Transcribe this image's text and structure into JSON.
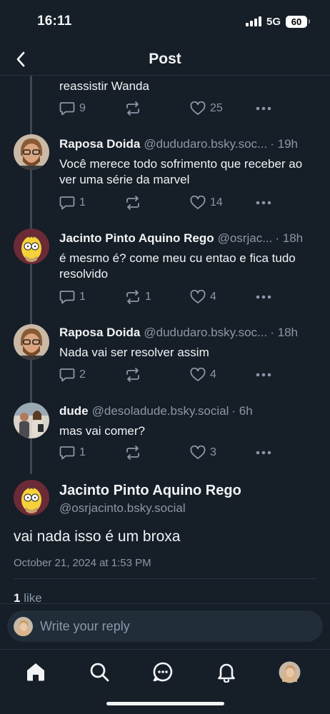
{
  "status_bar": {
    "time": "16:11",
    "network": "5G",
    "battery": "60"
  },
  "header": {
    "title": "Post"
  },
  "partial_reply": {
    "text": "reassistir Wanda",
    "replies": "9",
    "reposts": "",
    "likes": "25"
  },
  "replies": [
    {
      "name": "Raposa Doida",
      "handle": "@dududaro.bsky.soc...",
      "time": "· 19h",
      "text": "Você merece todo sofrimento que receber ao ver uma série da marvel",
      "replies": "1",
      "reposts": "",
      "likes": "14",
      "avatar": "bearded-man-glasses"
    },
    {
      "name": "Jacinto Pinto Aquino Rego",
      "handle": "@osrjac...",
      "time": "· 18h",
      "text": "é mesmo é? come meu cu entao e fica tudo resolvido",
      "replies": "1",
      "reposts": "1",
      "likes": "4",
      "avatar": "homer-simpson"
    },
    {
      "name": "Raposa Doida",
      "handle": "@dududaro.bsky.soc...",
      "time": "· 18h",
      "text": "Nada vai ser resolver assim",
      "replies": "2",
      "reposts": "",
      "likes": "4",
      "avatar": "bearded-man-glasses"
    },
    {
      "name": "dude",
      "handle": "@desoladude.bsky.social",
      "time": "· 6h",
      "text": "mas vai comer?",
      "replies": "1",
      "reposts": "",
      "likes": "3",
      "avatar": "group-photo"
    }
  ],
  "main_post": {
    "name": "Jacinto Pinto Aquino Rego",
    "handle": "@osrjacinto.bsky.social",
    "text": "vai nada isso é um broxa",
    "date": "October 21, 2024 at 1:53 PM",
    "like_count": "1",
    "like_label": "like"
  },
  "composer": {
    "placeholder": "Write your reply"
  },
  "tabbar": {
    "items": [
      "home-icon",
      "search-icon",
      "chat-icon",
      "bell-icon",
      "profile-avatar"
    ]
  },
  "colors": {
    "background": "#161e27",
    "text": "#f1f3f5",
    "muted": "#8b98a8",
    "thread_line": "#3a4858"
  }
}
